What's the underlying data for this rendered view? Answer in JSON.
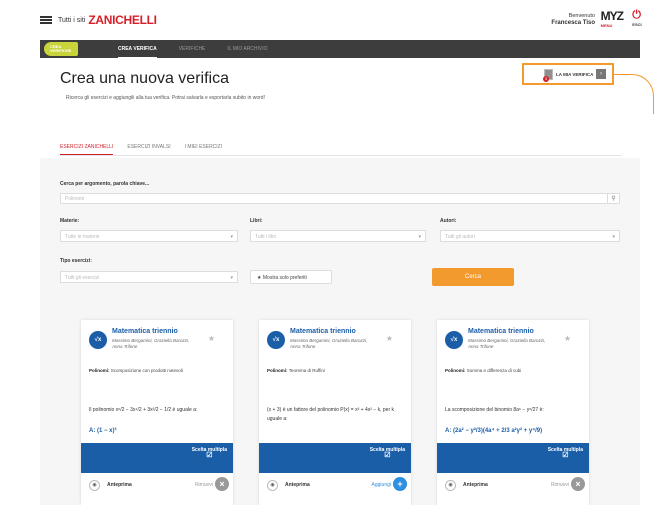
{
  "header": {
    "all_sites": "Tutti i siti",
    "brand": "ZANICHELLI",
    "welcome": "Benvenuto",
    "user": "Francesca Tiso",
    "myz": "MYZ",
    "menu_label": "MENU",
    "exit_label": "ESCI"
  },
  "nav": {
    "logo_line1": "CREA",
    "logo_line2": "VERIFICHE",
    "items": [
      {
        "label": "CREA VERIFICA",
        "active": true
      },
      {
        "label": "VERIFICHE"
      },
      {
        "label": "IL MIO ARCHIVIO"
      }
    ]
  },
  "page": {
    "title": "Crea una nuova verifica",
    "subtitle": "Ricerca gli esercizi e aggiungili alla tua verifica. Potrai salvarla e esportarla subito in word!",
    "my_test_label": "LA MIA VERIFICA",
    "my_test_count": "3"
  },
  "tabs": [
    {
      "label": "ESERCIZI ZANICHELLI",
      "active": true
    },
    {
      "label": "ESERCIZI INVALSI"
    },
    {
      "label": "I MIEI ESERCIZI"
    }
  ],
  "filters": {
    "search_label": "Cerca per argomento, parola chiave...",
    "search_value": "Polinomi",
    "materie_label": "Materie:",
    "materie_value": "Tutte le materie",
    "libri_label": "Libri:",
    "libri_value": "Tutti i libri",
    "autori_label": "Autori:",
    "autori_value": "Tutti gli autori",
    "tipo_label": "Tipo esercizi:",
    "tipo_value": "Tutti gli esercizi",
    "preferiti_label": "Mostra solo preferiti",
    "search_button": "Cerca"
  },
  "cards": [
    {
      "subject": "Matematica triennio",
      "authors": "Massimo Bergamini, Graziella Barozzi, Anna Trifone",
      "topic_key": "Polinomi",
      "topic": "Scomposizione con prodotti notevoli",
      "question": "Il polinomio x⁶/2 − 3x⁴/2 + 3x²/2 − 1/2 è uguale a:",
      "answer": "A: (1 − x)³",
      "type": "Scelta multipla",
      "preview": "Anteprima",
      "action": "Rimuovi",
      "action_color": "#999999"
    },
    {
      "subject": "Matematica triennio",
      "authors": "Massimo Bergamini, Graziella Barozzi, Anna Trifone",
      "topic_key": "Polinomi",
      "topic": "Teorema di Ruffini",
      "question": "(x + 3) è un fattore del polinomio P(x) = x³ + 4x² − k, per k uguale a:",
      "answer": "",
      "type": "Scelta multipla",
      "preview": "Anteprima",
      "action": "Aggiungi",
      "action_color": "#2d8fe0"
    },
    {
      "subject": "Matematica triennio",
      "authors": "Massimo Bergamini, Graziella Barozzi, Anna Trifone",
      "topic_key": "Polinomi",
      "topic": "Somma e differenza di cubi",
      "question": "La scomposizione del binomio 8a⁶ − y⁶/27 è:",
      "answer": "A: (2a² − y²/3)(4a⁴ + 2/3 a²y² + y⁴/9)",
      "type": "Scelta multipla",
      "preview": "Anteprima",
      "action": "Rimuovi",
      "action_color": "#999999"
    }
  ],
  "colors": {
    "brand_red": "#d5202a",
    "accent_orange": "#f29a2e",
    "card_blue": "#1b5ea8"
  }
}
